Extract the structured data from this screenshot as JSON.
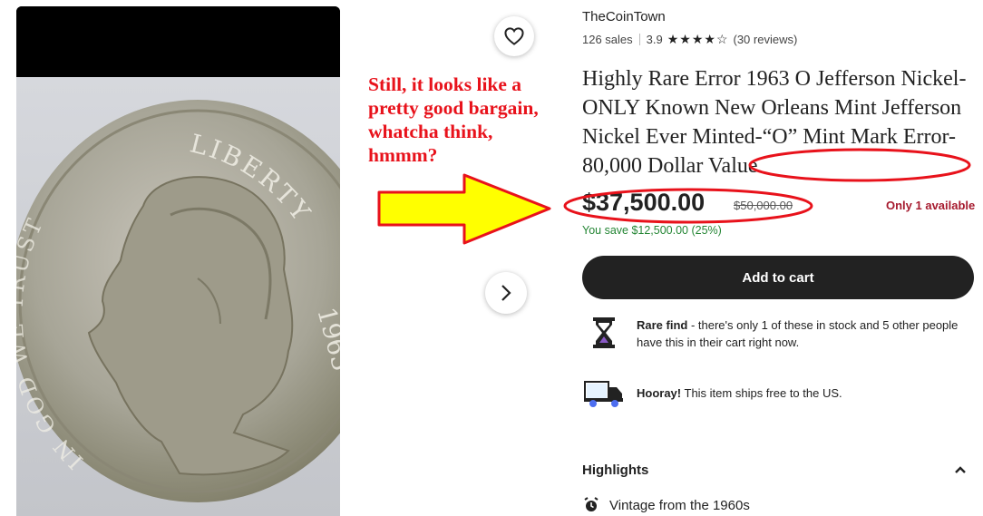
{
  "image_gallery": {
    "favorite_icon": "heart-outline-icon",
    "next_icon": "chevron-right-icon",
    "coin_inscriptions": {
      "top": "LIBERTY",
      "left": "IN GOD WE TRUST",
      "year": "1963"
    }
  },
  "annotation": {
    "text": "Still, it looks like a\npretty good bargain,\nwhatcha think,\nhmmm?",
    "color": "#e8121b",
    "arrow_fill": "#ffff00",
    "arrow_outline": "#e8121b"
  },
  "shop": {
    "name": "TheCoinTown",
    "sales": "126 sales",
    "rating": "3.9",
    "stars": "★★★★☆",
    "star_value": 3.9,
    "reviews": "(30 reviews)"
  },
  "listing": {
    "title_main": "Highly Rare Error 1963 O Jefferson Nickel- ONLY Known New Orleans Mint Jefferson Nickel Ever Minted-“O” Mint Mark Error- ",
    "title_highlight": "80,000 Dollar Value",
    "price": "$37,500.00",
    "original_price": "$50,000.00",
    "availability": "Only 1 available",
    "savings": "You save $12,500.00 (25%)",
    "add_to_cart_label": "Add to cart",
    "colors": {
      "savings": "#258635",
      "availability": "#a61a2e",
      "button": "#222222"
    }
  },
  "features": [
    {
      "icon": "hourglass-icon",
      "bold": "Rare find",
      "text": " - there's only 1 of these in stock and 5 other people have this in their cart right now."
    },
    {
      "icon": "delivery-truck-icon",
      "bold": "Hooray!",
      "text": " This item ships free to the US."
    }
  ],
  "highlights": {
    "heading": "Highlights",
    "toggle_icon": "chevron-up-icon",
    "items": [
      {
        "icon": "alarm-clock-icon",
        "text": "Vintage from the 1960s"
      }
    ]
  }
}
